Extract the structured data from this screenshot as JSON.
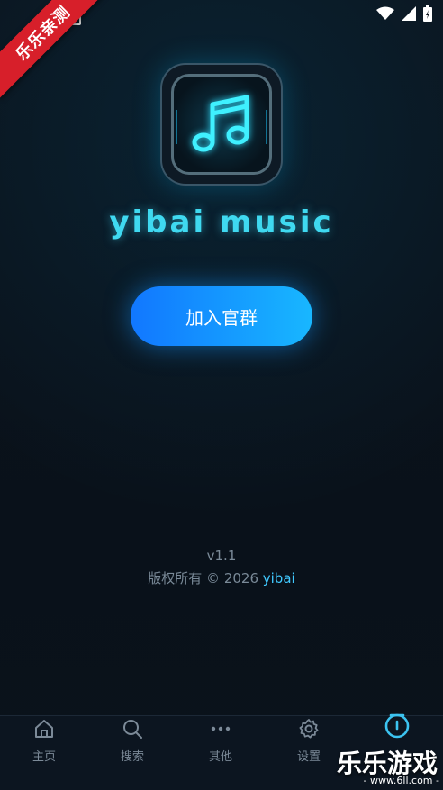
{
  "status_bar": {
    "icons": [
      "wifi-icon",
      "cell-signal-icon",
      "battery-icon"
    ]
  },
  "ribbon": {
    "text": "乐乐亲测"
  },
  "app": {
    "title": "yibai music",
    "logo_icon": "music-note-icon"
  },
  "actions": {
    "join_label": "加入官群"
  },
  "footer": {
    "version": "v1.1",
    "copyright_prefix": "版权所有 © 2026 ",
    "copyright_brand": "yibai"
  },
  "tabs": [
    {
      "label": "主页",
      "icon": "home-icon",
      "active": false
    },
    {
      "label": "搜索",
      "icon": "search-icon",
      "active": false
    },
    {
      "label": "其他",
      "icon": "more-icon",
      "active": false
    },
    {
      "label": "设置",
      "icon": "gear-icon",
      "active": false
    },
    {
      "label": "",
      "icon": "info-icon",
      "active": true
    }
  ],
  "watermark": {
    "title": "乐乐游戏",
    "url": "- www.6ll.com -"
  },
  "colors": {
    "accent": "#3fd9f0",
    "button_start": "#1177ff",
    "button_end": "#18b7ff",
    "background": "#0a1119"
  }
}
